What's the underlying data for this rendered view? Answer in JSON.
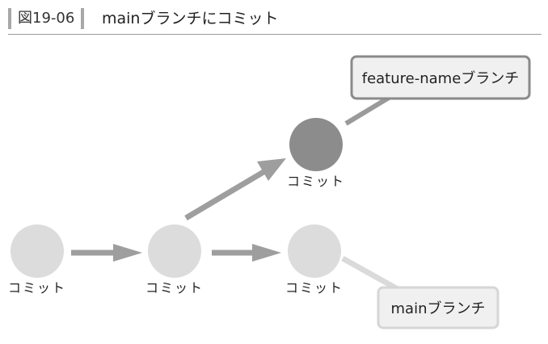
{
  "figure": {
    "number": "図19-06",
    "title": "mainブランチにコミット"
  },
  "commits": [
    {
      "label": "コミット",
      "state": "past"
    },
    {
      "label": "コミット",
      "state": "past"
    },
    {
      "label": "コミット",
      "state": "feature-head"
    },
    {
      "label": "コミット",
      "state": "new-main-head"
    }
  ],
  "branches": {
    "feature": {
      "label": "feature-nameブランチ"
    },
    "main": {
      "label": "mainブランチ"
    }
  },
  "colors": {
    "commit_light": "#dcdcdc",
    "commit_dark": "#8c8c8c",
    "arrow": "#9e9e9e",
    "feature_box_border": "#8a8a8a",
    "main_box_border": "#d6d6d6",
    "box_fill": "#f0f0f0",
    "main_connector": "#dadada"
  }
}
